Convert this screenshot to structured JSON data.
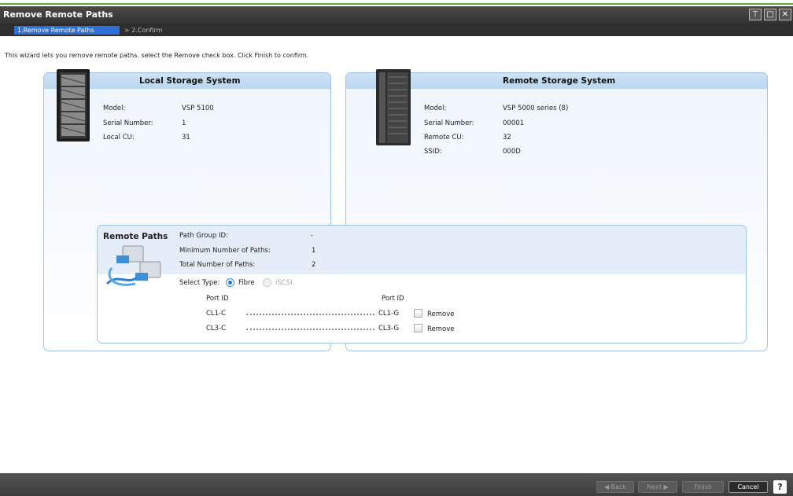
{
  "window": {
    "title": "Remove Remote Paths"
  },
  "steps": [
    {
      "label": "1.Remove Remote Paths",
      "active": true
    },
    {
      "label": "> 2.Confirm",
      "active": false
    }
  ],
  "instruction": "This wizard lets you remove remote paths. select the Remove check box. Click Finish to confirm.",
  "local": {
    "title": "Local Storage System",
    "fields": [
      {
        "label": "Model:",
        "value": "VSP 5100"
      },
      {
        "label": "Serial Number:",
        "value": "1"
      },
      {
        "label": "Local CU:",
        "value": "31"
      }
    ]
  },
  "remote": {
    "title": "Remote Storage System",
    "fields": [
      {
        "label": "Model:",
        "value": "VSP 5000 series (8)"
      },
      {
        "label": "Serial Number:",
        "value": "00001"
      },
      {
        "label": "Remote CU:",
        "value": "32"
      },
      {
        "label": "SSID:",
        "value": "000D"
      }
    ]
  },
  "remote_paths": {
    "title": "Remote Paths",
    "fields": [
      {
        "label": "Path Group ID:",
        "value": "-"
      },
      {
        "label": "Minimum Number of Paths:",
        "value": "1"
      },
      {
        "label": "Total Number of Paths:",
        "value": "2"
      }
    ],
    "select_type_label": "Select Type:",
    "types": [
      {
        "label": "Fibre",
        "selected": true
      },
      {
        "label": "iSCSI",
        "selected": false
      }
    ],
    "local_port_header": "Port ID",
    "remote_port_header": "Port ID",
    "rows": [
      {
        "local_port": "CL1-C",
        "remote_port": "CL1-G",
        "remove_label": "Remove",
        "checked": false
      },
      {
        "local_port": "CL3-C",
        "remote_port": "CL3-G",
        "remove_label": "Remove",
        "checked": false
      }
    ]
  },
  "footer": {
    "back": "◀ Back",
    "next": "Next ▶",
    "finish": "Finish",
    "cancel": "Cancel",
    "help": "?"
  },
  "colors": {
    "accent": "#2f6fd8",
    "panel_border": "#9fc1e2",
    "title_bar": "#3a3a3a",
    "green_line": "#5aa83a"
  }
}
